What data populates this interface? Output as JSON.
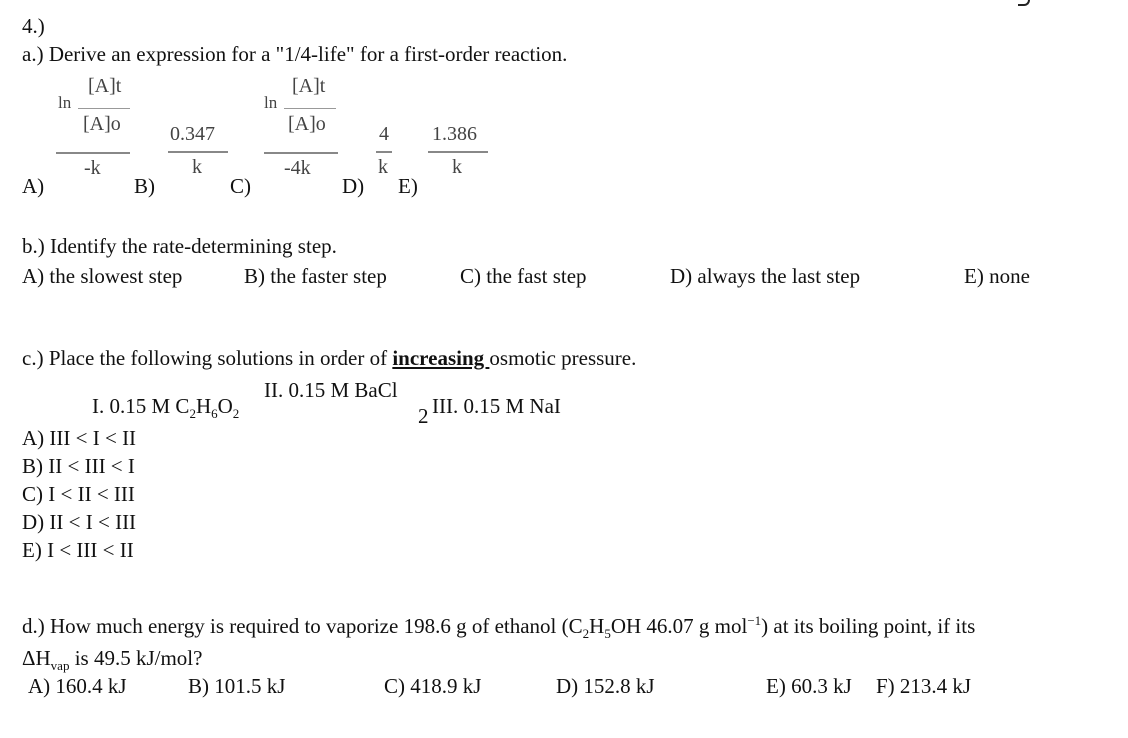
{
  "question_number": "4.)",
  "part_a": {
    "prompt": "a.) Derive an expression for a \"1/4-life\" for a first-order reaction.",
    "choices": [
      {
        "label": "A)",
        "ln": "ln",
        "inner_num": "[A]t",
        "inner_den": "[A]o",
        "den": "-k"
      },
      {
        "label": "B)",
        "num": "0.347",
        "den": "k"
      },
      {
        "label": "C)",
        "ln": "ln",
        "inner_num": "[A]t",
        "inner_den": "[A]o",
        "den": "-4k"
      },
      {
        "label": "D)",
        "num": "4",
        "den": "k"
      },
      {
        "label": "E)",
        "num": "1.386",
        "den": "k"
      }
    ]
  },
  "part_b": {
    "prompt": "b.) Identify the rate-determining step.",
    "choices": [
      "A) the slowest step",
      "B) the faster step",
      "C) the fast step",
      "D) always the last step",
      "E) none"
    ]
  },
  "part_c": {
    "prompt_before": "c.) Place the following solutions in order of ",
    "prompt_emphasis": "increasing ",
    "prompt_after": "osmotic pressure.",
    "solution_I": {
      "text": "I. 0.15 M C",
      "s1": "2",
      "h": "H",
      "s2": "6",
      "o": "O",
      "s3": "2"
    },
    "solution_II": {
      "text": "II. 0.15 M BaCl",
      "sub": "2"
    },
    "solution_III": "III. 0.15 M NaI",
    "choices": [
      "A) III < I < II",
      "B) II < III < I",
      "C) I < II < III",
      "D) II < I < III",
      "E) I < III < II"
    ]
  },
  "part_d": {
    "line1_a": "d.) How much energy is required to vaporize 198.6 g of ethanol (C",
    "line1_sub1": "2",
    "line1_b": "H",
    "line1_sub2": "5",
    "line1_c": "OH 46.07 g mol",
    "line1_sup": "−1",
    "line1_d": ") at its boiling point, if its",
    "line2_a": "ΔH",
    "line2_sub": "vap",
    "line2_b": " is 49.5 kJ/mol?",
    "choices": [
      "A) 160.4 kJ",
      "B) 101.5 kJ",
      "C) 418.9 kJ",
      "D) 152.8 kJ",
      "E) 60.3 kJ",
      "F) 213.4 kJ"
    ]
  }
}
